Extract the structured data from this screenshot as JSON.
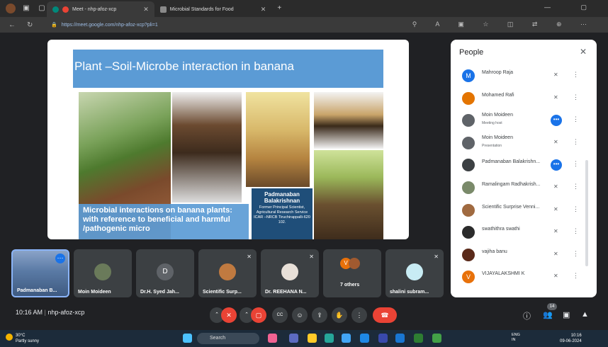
{
  "browser": {
    "tabs": [
      {
        "label": "Meet - nhp-afoz-xcp"
      },
      {
        "label": "Microbial Standards for Food"
      }
    ],
    "url": "https://meet.google.com/nhp-afoz-xcp?pli=1"
  },
  "slide": {
    "title": "Plant –Soil-Microbe interaction in banana",
    "caption": "Microbial interactions on banana plants: with reference to beneficial and harmful /pathogenic micro",
    "presenter_name": "Padmanaban Balakrishnan",
    "presenter_details": "Former Principal Scientist, Agricultural Research Service ICAR –NRCB Tiruchirappalli-620 102."
  },
  "tiles": [
    {
      "name": "Padmanaban B..."
    },
    {
      "name": "Moin Moideen"
    },
    {
      "name": "Dr.H. Syed Jah...",
      "initial": "D"
    },
    {
      "name": "Scientific Surp..."
    },
    {
      "name": "Dr. REEHANA N..."
    },
    {
      "name": "7 others"
    },
    {
      "name": "shalini subram..."
    }
  ],
  "people": {
    "title": "People",
    "participants": [
      {
        "name": "Mahroop Raja",
        "initial": "M",
        "color": "#1a73e8"
      },
      {
        "name": "Mohamed Rafi",
        "initial": "",
        "color": "#e37400"
      },
      {
        "name": "Moin Moideen",
        "sub": "Meeting host",
        "color": "#5f6368"
      },
      {
        "name": "Moin Moideen",
        "sub": "Presentation",
        "color": "#5f6368"
      },
      {
        "name": "Padmanaban Balakrishn...",
        "color": "#3c4043"
      },
      {
        "name": "Ramalingam Radhakrish...",
        "color": "#7a8a6a"
      },
      {
        "name": "Scientific Surprise Venni...",
        "color": "#a06a40"
      },
      {
        "name": "swathithra swathi",
        "color": "#2b2b2b"
      },
      {
        "name": "vajiha banu",
        "color": "#5a2a1a"
      },
      {
        "name": "VIJAYALAKSHMI K",
        "initial": "V",
        "color": "#e8710a"
      }
    ]
  },
  "bottom_bar": {
    "time": "10:16 AM",
    "meeting_code": "nhp-afoz-xcp",
    "people_count": "14"
  },
  "taskbar": {
    "temperature": "30°C",
    "weather": "Partly sunny",
    "search_placeholder": "Search",
    "lang": "ENG",
    "region": "IN",
    "clock_time": "10:16",
    "clock_date": "09-06-2024"
  }
}
